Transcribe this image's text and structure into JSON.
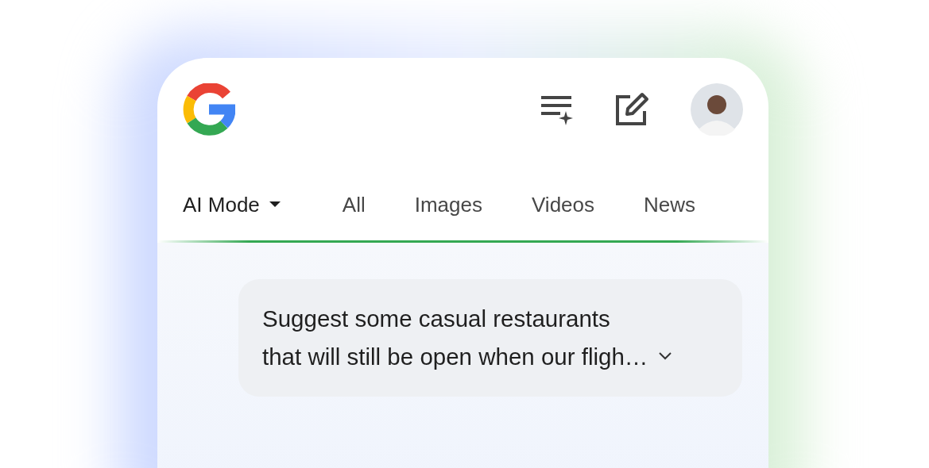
{
  "tabs": [
    {
      "label": "AI Mode",
      "selected": true,
      "dropdown": true
    },
    {
      "label": "All",
      "selected": false,
      "dropdown": false
    },
    {
      "label": "Images",
      "selected": false,
      "dropdown": false
    },
    {
      "label": "Videos",
      "selected": false,
      "dropdown": false
    },
    {
      "label": "News",
      "selected": false,
      "dropdown": false
    }
  ],
  "query": {
    "text": "Suggest some casual restaurants\nthat will still be open when our fligh…",
    "expandable": true
  }
}
